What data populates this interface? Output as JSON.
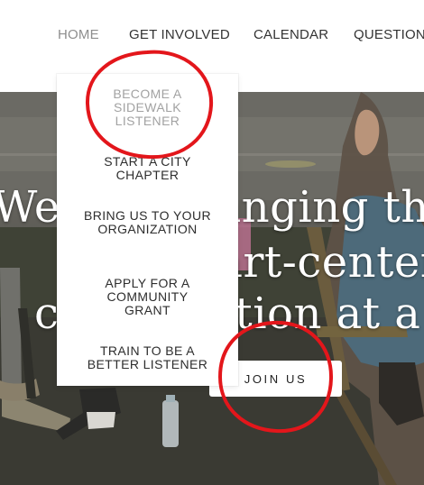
{
  "nav": {
    "items": [
      {
        "label": "HOME",
        "active": true
      },
      {
        "label": "GET INVOLVED",
        "active": false
      },
      {
        "label": "CALENDAR",
        "active": false
      },
      {
        "label": "QUESTIONS",
        "active": false
      }
    ]
  },
  "dropdown": {
    "items": [
      {
        "label": "BECOME A SIDEWALK LISTENER",
        "current": true
      },
      {
        "label": "START A CITY CHAPTER",
        "current": false
      },
      {
        "label": "BRING US TO YOUR ORGANIZATION",
        "current": false
      },
      {
        "label": "APPLY FOR A COMMUNITY GRANT",
        "current": false
      },
      {
        "label": "TRAIN TO BE A BETTER LISTENER",
        "current": false
      }
    ]
  },
  "hero": {
    "headline_lines": [
      "We are changing the",
      "heart-centered",
      "conversation at a time"
    ],
    "cta_label": "JOIN US"
  },
  "colors": {
    "nav_text": "#333333",
    "nav_active": "#8e8e8e",
    "dropdown_current": "#a2a2a2",
    "annotation_red": "#e3161b"
  }
}
